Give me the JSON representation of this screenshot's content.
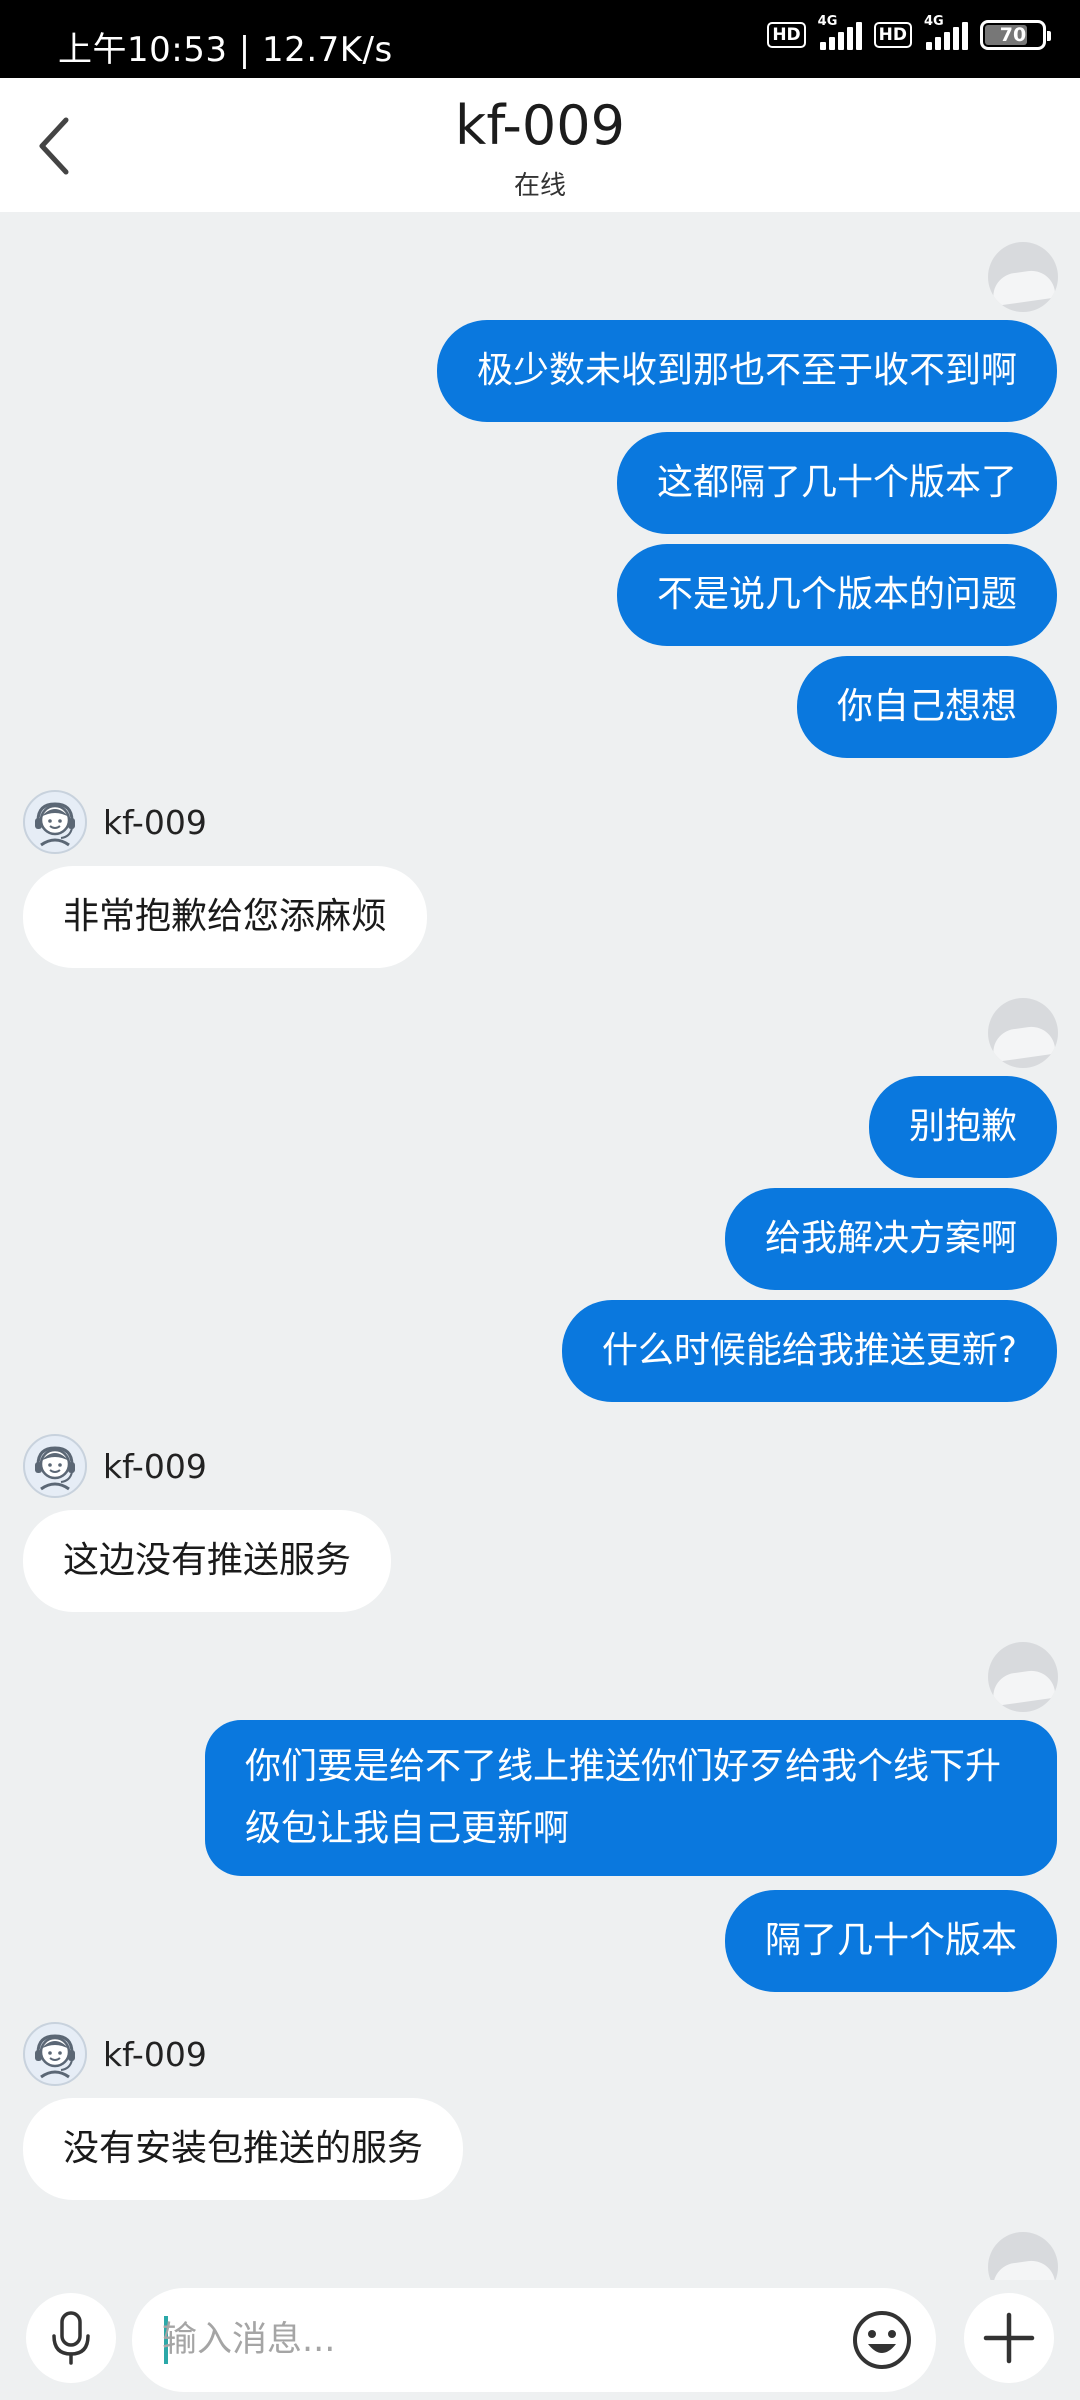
{
  "status_bar": {
    "time": "上午10:53 | 12.7K/s",
    "hd1": "HD",
    "net1": "4G",
    "hd2": "HD",
    "net2": "4G",
    "battery": "70"
  },
  "header": {
    "title": "kf-009",
    "subtitle": "在线"
  },
  "messages": [
    {
      "dir": "out",
      "text": "极少数未收到那也不至于收不到啊"
    },
    {
      "dir": "out",
      "text": "这都隔了几十个版本了"
    },
    {
      "dir": "out",
      "text": "不是说几个版本的问题"
    },
    {
      "dir": "out",
      "text": "你自己想想"
    },
    {
      "dir": "in",
      "sender": "kf-009",
      "text": "非常抱歉给您添麻烦"
    },
    {
      "dir": "out",
      "text": "别抱歉"
    },
    {
      "dir": "out",
      "text": "给我解决方案啊"
    },
    {
      "dir": "out",
      "text": "什么时候能给我推送更新?"
    },
    {
      "dir": "in",
      "sender": "kf-009",
      "text": "这边没有推送服务"
    },
    {
      "dir": "out",
      "text": "你们要是给不了线上推送你们好歹给我个线下升级包让我自己更新啊"
    },
    {
      "dir": "out",
      "text": "隔了几十个版本"
    },
    {
      "dir": "in",
      "sender": "kf-009",
      "text": "没有安装包推送的服务"
    }
  ],
  "input": {
    "placeholder": "输入消息..."
  },
  "colors": {
    "outgoing_bubble": "#0a78de",
    "incoming_bubble": "#ffffff",
    "background": "#eef0f1"
  },
  "icons": {
    "back": "chevron-left-icon",
    "mic": "microphone-icon",
    "emoji": "smiley-icon",
    "plus": "plus-icon"
  }
}
